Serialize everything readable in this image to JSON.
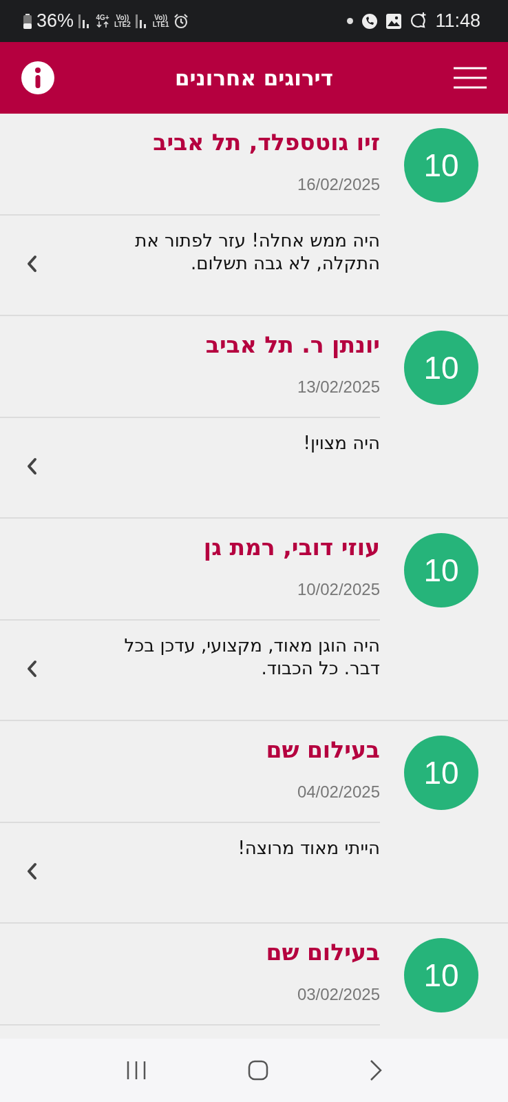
{
  "status_bar": {
    "battery": "36%",
    "sims": [
      {
        "volte": "Vo))",
        "lte": "LTE1"
      },
      {
        "network": "4G+",
        "volte": "Vo))",
        "lte": "LTE2"
      }
    ],
    "time": "11:48"
  },
  "header": {
    "title": "דירוגים אחרונים"
  },
  "reviews": [
    {
      "score": "10",
      "name": "זיו גוטספלד, תל אביב",
      "date": "16/02/2025",
      "comment": "היה ממש אחלה! עזר לפתור את התקלה, לא גבה תשלום."
    },
    {
      "score": "10",
      "name": "יונתן ר. תל אביב",
      "date": "13/02/2025",
      "comment": "היה מצוין!"
    },
    {
      "score": "10",
      "name": "עוזי דובי, רמת גן",
      "date": "10/02/2025",
      "comment": "היה הוגן מאוד, מקצועי, עדכן בכל דבר. כל הכבוד."
    },
    {
      "score": "10",
      "name": "בעילום שם",
      "date": "04/02/2025",
      "comment": "הייתי מאוד מרוצה!"
    },
    {
      "score": "10",
      "name": "בעילום שם",
      "date": "03/02/2025"
    }
  ]
}
